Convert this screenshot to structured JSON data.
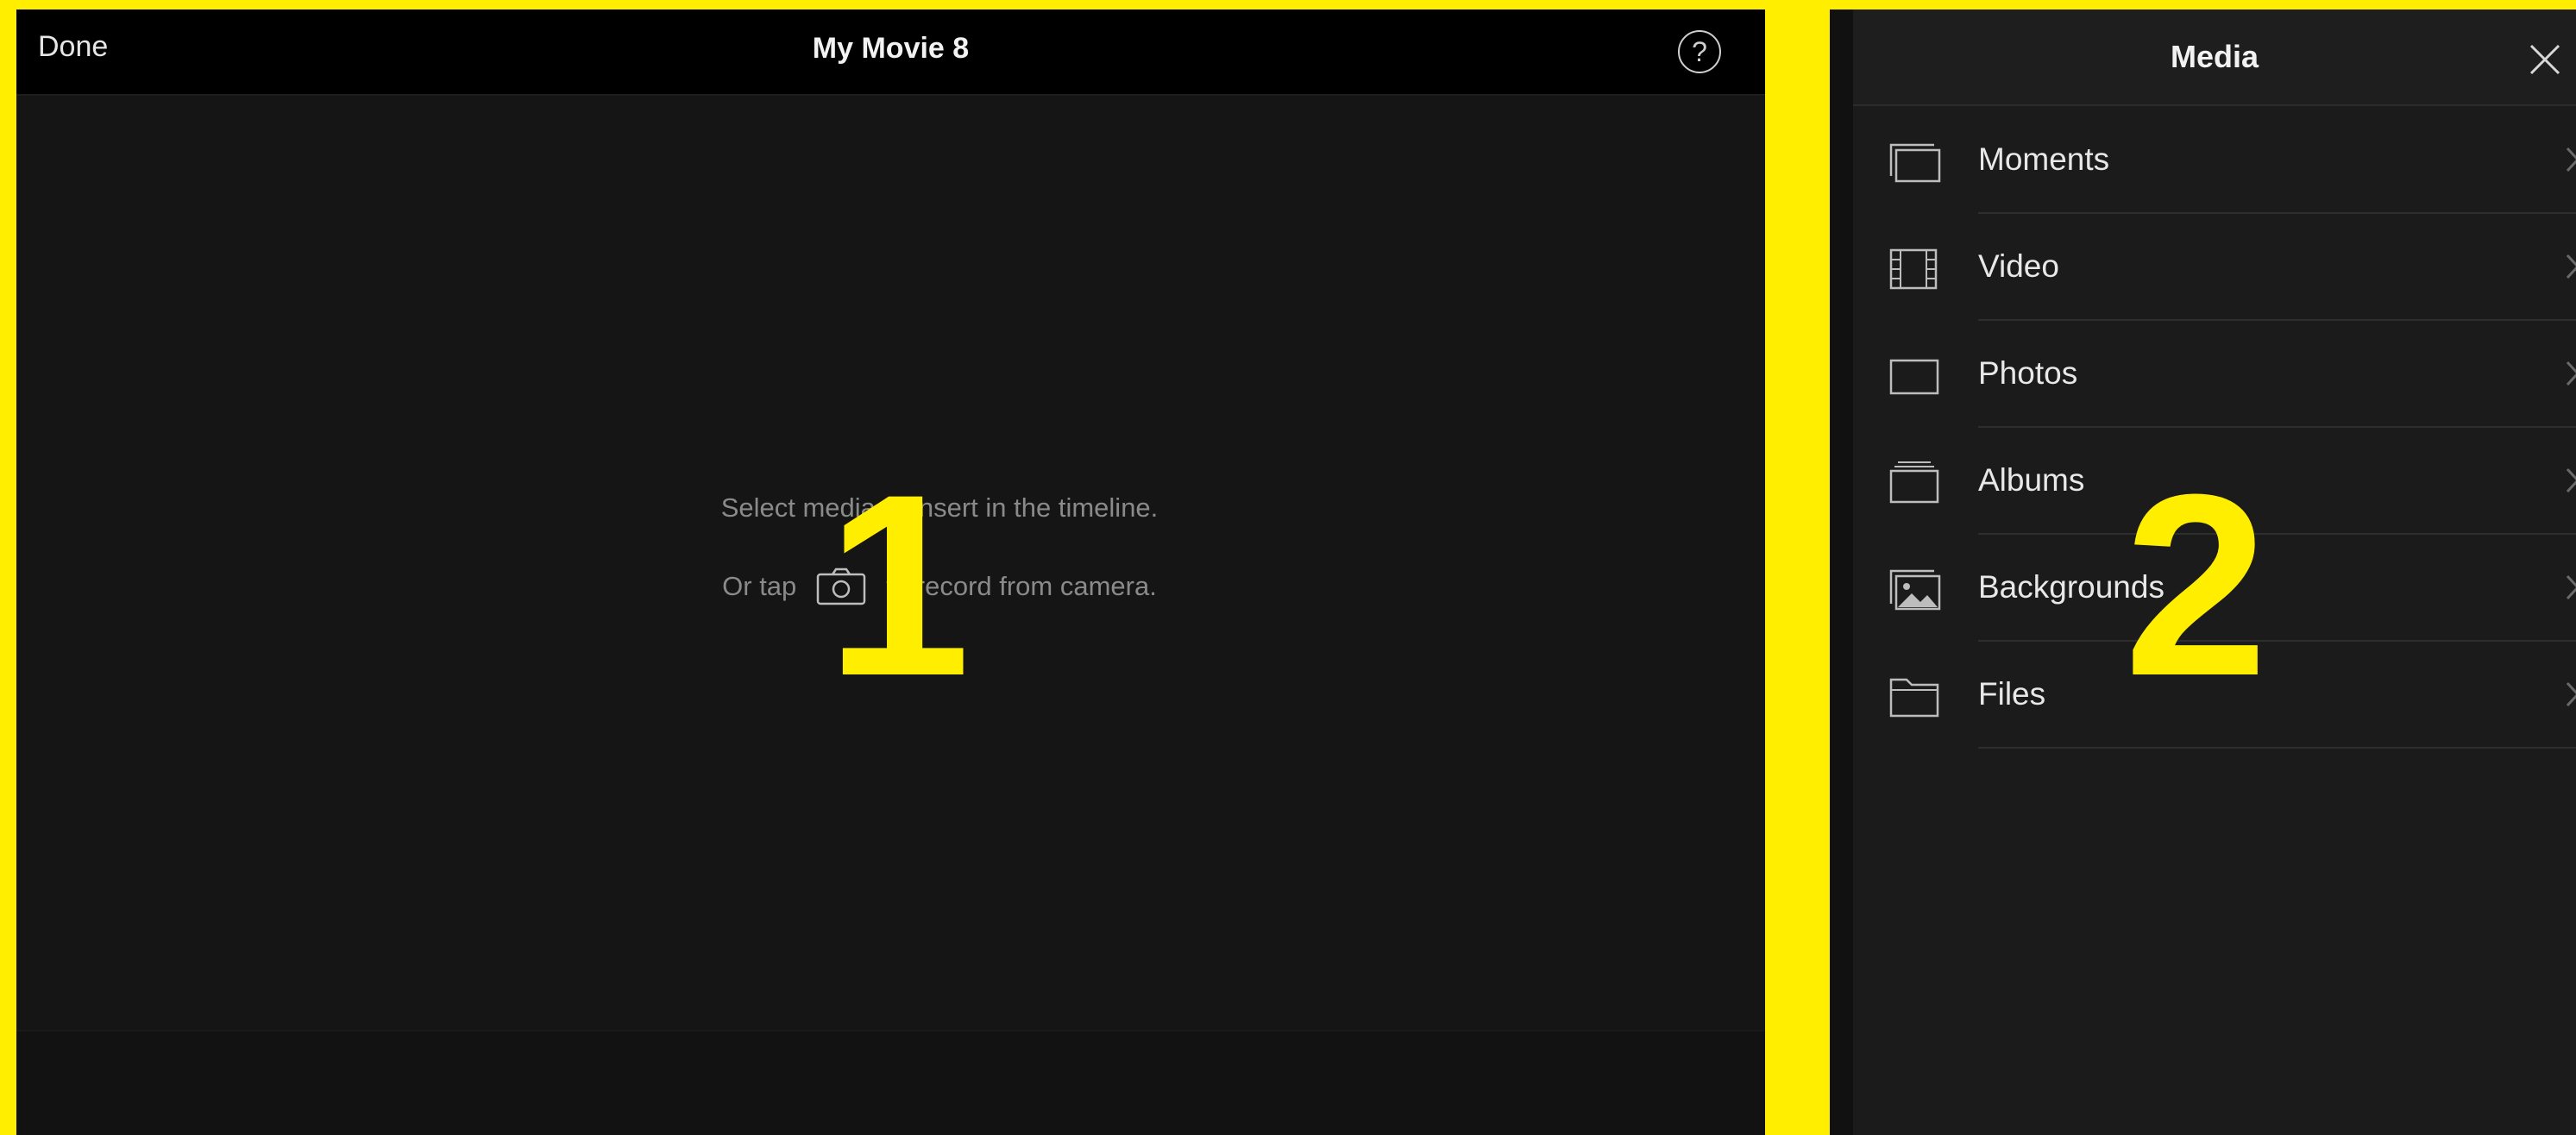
{
  "left_panel": {
    "header": {
      "done_label": "Done",
      "title": "My Movie 8",
      "help_label": "?"
    },
    "empty_state": {
      "line1": "Select media to insert in the timeline.",
      "line2_prefix": "Or tap",
      "line2_suffix": "to record from camera.",
      "camera_icon": "camera-icon"
    }
  },
  "right_panel": {
    "title": "Media",
    "close_icon": "close-icon",
    "items": [
      {
        "label": "Moments",
        "icon": "moments-icon"
      },
      {
        "label": "Video",
        "icon": "film-icon"
      },
      {
        "label": "Photos",
        "icon": "photo-frame-icon"
      },
      {
        "label": "Albums",
        "icon": "albums-icon"
      },
      {
        "label": "Backgrounds",
        "icon": "backgrounds-icon"
      },
      {
        "label": "Files",
        "icon": "folder-icon"
      }
    ]
  },
  "overlays": {
    "marker_1": "1",
    "marker_2": "2"
  },
  "colors": {
    "highlight": "#FFEE00",
    "panel_bg": "#151515",
    "header_bg": "#000000",
    "text_primary": "#E8E8E8",
    "text_muted": "#8A8A8A"
  }
}
